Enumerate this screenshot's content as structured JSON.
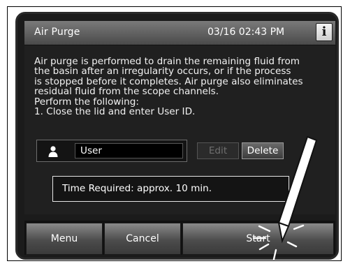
{
  "titlebar": {
    "title": "Air Purge",
    "datetime": "03/16 02:43 PM",
    "info_label": "i"
  },
  "description": {
    "lines": [
      "Air purge is performed to drain the remaining fluid from",
      "the basin after an irregularity occurs, or if the process",
      "is stopped before it completes. Air purge also eliminates",
      "residual fluid from the scope channels.",
      "Perform the following:",
      "1. Close the lid and enter User ID."
    ]
  },
  "user": {
    "field_value": "User",
    "edit_label": "Edit",
    "delete_label": "Delete"
  },
  "time_required": "Time Required: approx. 10 min.",
  "buttons": {
    "menu": "Menu",
    "cancel": "Cancel",
    "start": "Start"
  },
  "icons": {
    "info": "info-icon",
    "user": "person-icon",
    "stylus": "stylus-icon",
    "tap": "tap-burst-icon"
  }
}
